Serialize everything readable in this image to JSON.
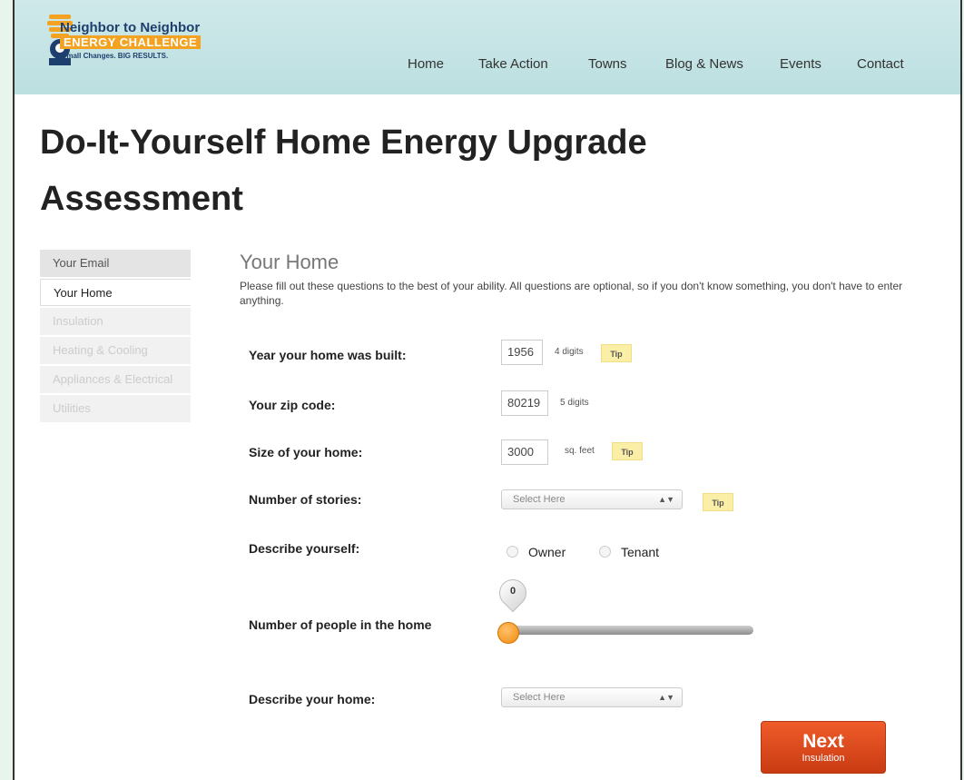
{
  "logo": {
    "line1": "Neighbor to Neighbor",
    "line2": "ENERGY CHALLENGE",
    "tagline": "Small Changes. BIG RESULTS.",
    "icon": "lightbulb-person-icon"
  },
  "nav": {
    "items": [
      "Home",
      "Take Action",
      "Towns",
      "Blog & News",
      "Events",
      "Contact"
    ]
  },
  "page": {
    "title": "Do-It-Yourself Home Energy Upgrade Assessment"
  },
  "sidebar": {
    "items": [
      {
        "label": "Your Email",
        "state": "done"
      },
      {
        "label": "Your Home",
        "state": "current"
      },
      {
        "label": "Insulation",
        "state": "disabled"
      },
      {
        "label": "Heating & Cooling",
        "state": "disabled"
      },
      {
        "label": "Appliances & Electrical",
        "state": "disabled"
      },
      {
        "label": "Utilities",
        "state": "disabled"
      }
    ]
  },
  "section": {
    "title": "Your Home",
    "intro": "Please fill out these questions to the best of your ability. All questions are optional, so if you don't know something, you don't have to enter anything."
  },
  "form": {
    "year_built": {
      "label": "Year your home was built:",
      "value": "1956",
      "hint": "4 digits",
      "tip": "Tip"
    },
    "zip": {
      "label": "Your zip code:",
      "value": "80219",
      "hint": "5 digits"
    },
    "size": {
      "label": "Size of your home:",
      "value": "3000",
      "hint": "sq. feet",
      "tip": "Tip"
    },
    "stories": {
      "label": "Number of stories:",
      "selected": "Select Here",
      "tip": "Tip"
    },
    "describe_yourself": {
      "label": "Describe yourself:",
      "options": [
        "Owner",
        "Tenant"
      ]
    },
    "people": {
      "label": "Number of people in the home",
      "value": "0",
      "fraction": 0
    },
    "describe_home": {
      "label": "Describe your home:",
      "selected": "Select Here"
    }
  },
  "next_button": {
    "label": "Next",
    "sublabel": "Insulation"
  },
  "colors": {
    "header": "#bcdfe0",
    "accent_orange": "#f3a321",
    "next_button": "#d9441a",
    "tip_yellow": "#fbeea6",
    "slider_thumb": "#f28b10"
  }
}
